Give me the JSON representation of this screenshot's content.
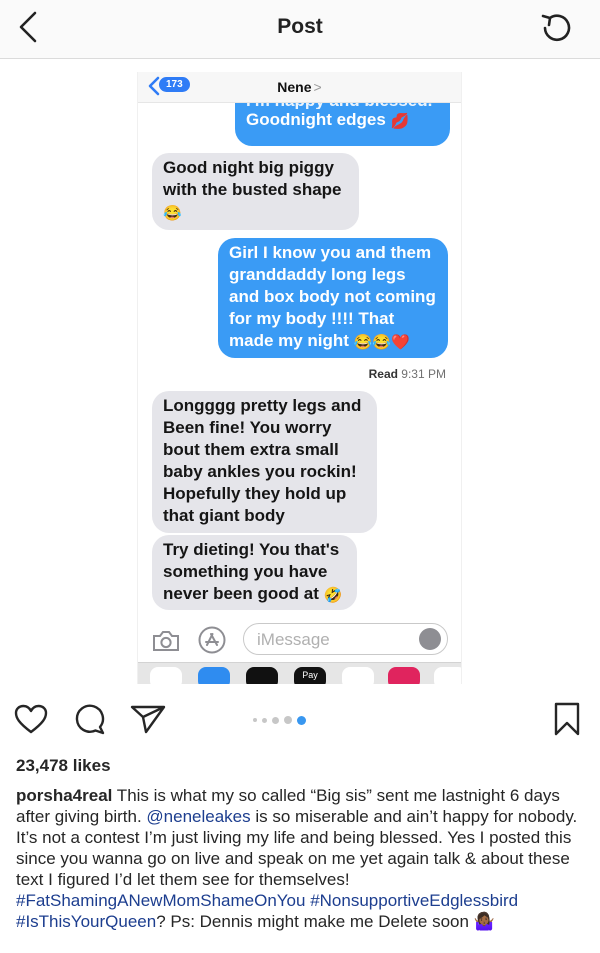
{
  "header": {
    "title": "Post",
    "back_icon": "chevron-left-icon",
    "refresh_icon": "refresh-icon"
  },
  "imessage": {
    "back_count": "173",
    "contact_name": "Nene",
    "contact_chevron": ">",
    "messages": [
      {
        "dir": "out",
        "cut_text": "I'm happy and blessed.",
        "text": "Goodnight edges",
        "emoji": "💋"
      },
      {
        "dir": "in",
        "lines": [
          "Good night big piggy",
          "with the busted shape"
        ],
        "emoji": "😂"
      },
      {
        "dir": "out",
        "lines": [
          "Girl I know you and them",
          "granddaddy long legs",
          "and box body not coming",
          "for my body !!!! That",
          "made my night"
        ],
        "emoji": "😂😂❤️"
      },
      {
        "dir": "in",
        "lines": [
          "Longggg pretty legs and",
          "Been fine! You worry",
          "bout them extra small",
          "baby ankles you rockin!",
          "Hopefully they hold up",
          "that giant body"
        ]
      },
      {
        "dir": "in",
        "lines": [
          "Try dieting! You that's",
          "something you have",
          "never been good at"
        ],
        "emoji": "🤣"
      }
    ],
    "read_label": "Read",
    "read_time": "9:31 PM",
    "input_placeholder": "iMessage",
    "app_pay_label": "Pay"
  },
  "post": {
    "likes": "23,478 likes",
    "username": "porsha4real",
    "caption_parts": [
      " This is what my so called “Big sis” sent me lastnight 6 days after giving birth. ",
      "@neneleakes",
      " is so miserable and ain’t happy for nobody. It’s not a contest I’m just living my life and being blessed. Yes I posted this since you wanna go on live and speak on me yet again talk & about these text I figured I’d let them see for themselves! ",
      "#FatShamingANewMomShameOnYou",
      " ",
      "#NonsupportiveEdglessbird",
      " ",
      "#IsThisYourQueen",
      "? Ps: Dennis might make me Delete soon ",
      "🤷🏾‍♀️"
    ],
    "carousel": {
      "count": 5,
      "active_index": 4
    }
  },
  "colors": {
    "imessage_blue": "#3a9bf5",
    "received_gray": "#e5e5ea",
    "link_blue": "#1d3e8f",
    "active_dot": "#3897f0"
  }
}
